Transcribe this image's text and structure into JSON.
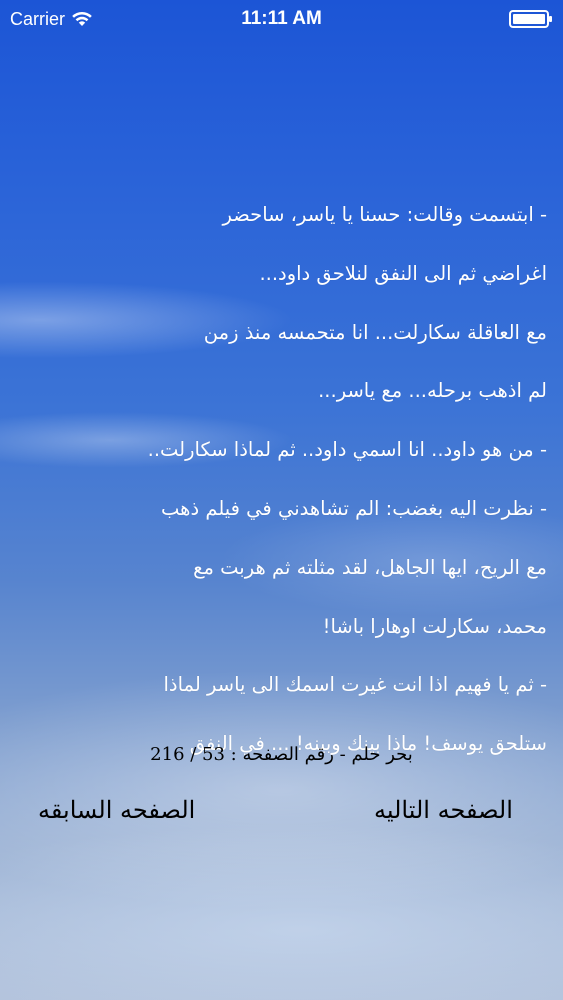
{
  "status_bar": {
    "carrier": "Carrier",
    "time": "11:11 AM",
    "wifi_icon": "wifi-icon",
    "battery_icon": "battery-icon"
  },
  "story": {
    "lines": [
      "-          ابتسمت وقالت: حسنا يا ياسر، ساحضر",
      "اغراضي ثم الى النفق لنلاحق داود...",
      "مع العاقلة سكارلت... انا متحمسه منذ زمن",
      "لم اذهب برحله... مع ياسر...",
      "-          من هو داود.. انا اسمي داود.. ثم لماذا سكارلت..",
      "-          نظرت اليه بغضب: الم تشاهدني في فيلم ذهب",
      "مع الريح، ايها الجاهل، لقد مثلته ثم هربت مع",
      "محمد، سكارلت اوهارا باشا!",
      "-          ثم يا فهيم اذا انت غيرت اسمك الى ياسر لماذا",
      "ستلحق يوسف! ماذا بينك وبينه! ... في النفق"
    ]
  },
  "page_counter": {
    "text": "بحر حلم - رقم الصفحه : 53 / 216"
  },
  "navigation": {
    "next_label": "الصفحه التاليه",
    "previous_label": "الصفحه السابقه"
  }
}
